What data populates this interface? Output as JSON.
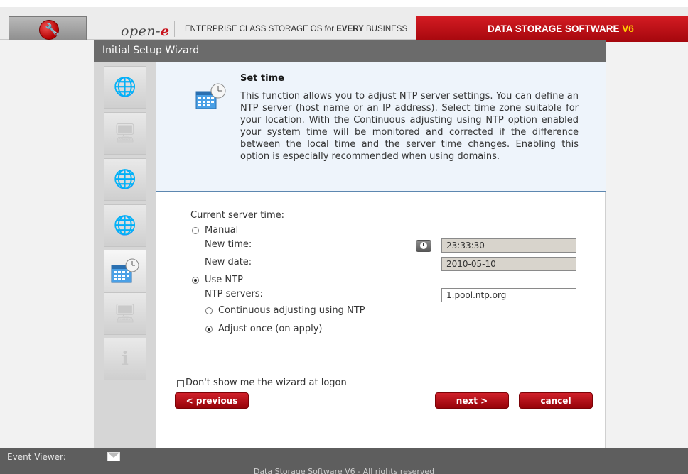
{
  "header": {
    "brand_prefix": "open-",
    "brand_suffix": "e",
    "tagline_prefix": "ENTERPRISE CLASS STORAGE OS for ",
    "tagline_bold": "EVERY",
    "tagline_suffix": " BUSINESS",
    "product_name": "DATA STORAGE SOFTWARE ",
    "product_version": "V6"
  },
  "wizard": {
    "title": "Initial Setup Wizard",
    "steps": [
      {
        "icon": "globe-icon",
        "active": false
      },
      {
        "icon": "lock-monitor-icon",
        "active": false
      },
      {
        "icon": "network-globe-icon",
        "active": false
      },
      {
        "icon": "globe-clock-icon",
        "active": false
      },
      {
        "icon": "calendar-clock-icon",
        "active": true
      },
      {
        "icon": "server-icon",
        "active": false
      },
      {
        "icon": "info-icon",
        "active": false
      }
    ]
  },
  "intro": {
    "title": "Set time",
    "description": "This function allows you to adjust NTP server settings. You can define an NTP server (host name or an IP address). Select time zone suitable for your location. With the Continuous adjusting using NTP option enabled your system time will be monitored and corrected if the difference between the local time and the server time changes. Enabling this option is especially recommended when using domains."
  },
  "form": {
    "current_time_label": "Current server time:",
    "manual_label": "Manual",
    "manual_selected": false,
    "new_time_label": "New time:",
    "new_time_value": "23:33:30",
    "new_date_label": "New date:",
    "new_date_value": "2010-05-10",
    "use_ntp_label": "Use NTP",
    "use_ntp_selected": true,
    "ntp_servers_label": "NTP servers:",
    "ntp_servers_value": "1.pool.ntp.org",
    "continuous_label": "Continuous adjusting using NTP",
    "continuous_selected": false,
    "adjust_once_label": "Adjust once (on apply)",
    "adjust_once_selected": true,
    "dont_show_label": "Don't show me the wizard at logon",
    "dont_show_checked": false
  },
  "buttons": {
    "previous": "< previous",
    "next": "next >",
    "cancel": "cancel"
  },
  "footer": {
    "event_viewer_label": "Event Viewer:",
    "copyright": "Data Storage Software V6 - All rights reserved"
  },
  "colors": {
    "accent_red": "#c8101a",
    "title_bar": "#6b6b6b",
    "intro_bg": "#eef4fb"
  }
}
